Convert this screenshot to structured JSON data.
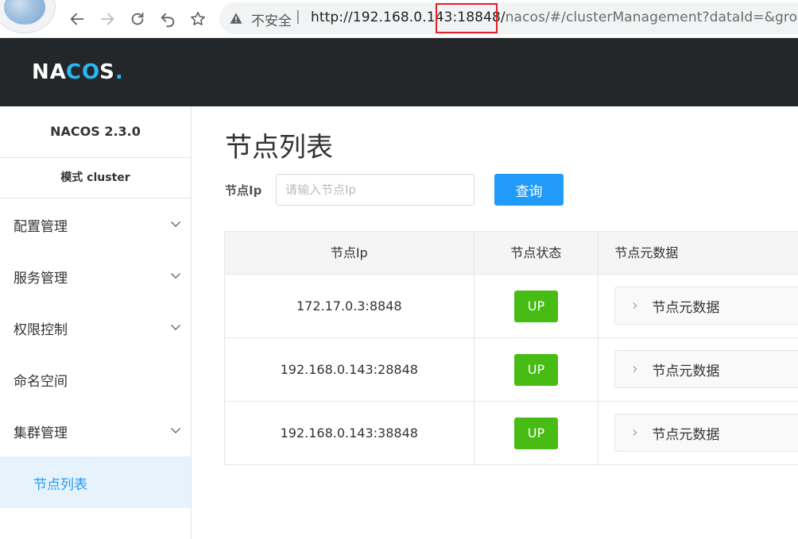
{
  "browser": {
    "insecure_label": "不安全",
    "separator": "|",
    "url_host": "http://192.168.0.143:18848/",
    "url_path": "nacos/#/clusterManagement?dataId=&group"
  },
  "header": {
    "logo_text_a": "NA",
    "logo_text_co": "CO",
    "logo_text_s": "S",
    "logo_dot": "."
  },
  "sidebar": {
    "version": "NACOS 2.3.0",
    "mode": "模式 cluster",
    "items": [
      {
        "label": "配置管理"
      },
      {
        "label": "服务管理"
      },
      {
        "label": "权限控制"
      },
      {
        "label": "命名空间"
      },
      {
        "label": "集群管理"
      },
      {
        "label": "节点列表"
      }
    ]
  },
  "main": {
    "title": "节点列表",
    "filter_label": "节点Ip",
    "filter_placeholder": "请输入节点Ip",
    "filter_value": "",
    "query_label": "查询",
    "columns": [
      "节点Ip",
      "节点状态",
      "节点元数据"
    ],
    "rows": [
      {
        "ip": "172.17.0.3:8848",
        "state": "UP",
        "meta": "节点元数据"
      },
      {
        "ip": "192.168.0.143:28848",
        "state": "UP",
        "meta": "节点元数据"
      },
      {
        "ip": "192.168.0.143:38848",
        "state": "UP",
        "meta": "节点元数据"
      }
    ]
  },
  "colors": {
    "accent": "#209bfa",
    "status_up": "#46bc15",
    "header_bg": "#242729",
    "highlight_box": "#e0232a"
  }
}
